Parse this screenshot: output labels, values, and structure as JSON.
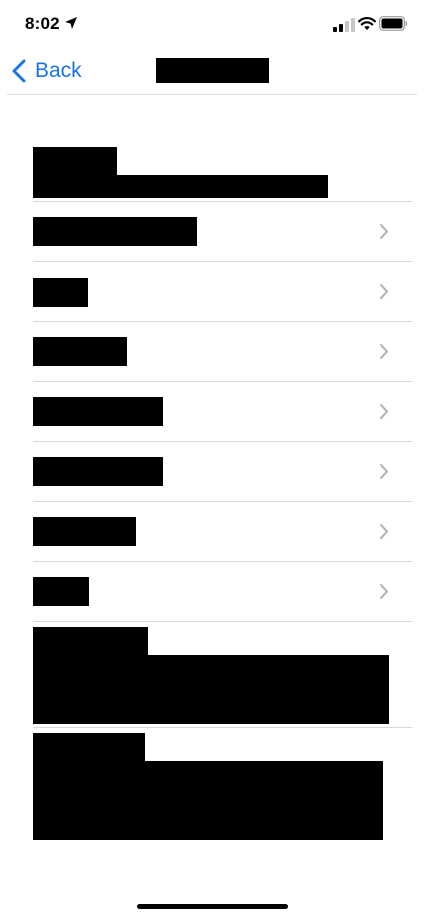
{
  "status_bar": {
    "time": "8:02"
  },
  "nav": {
    "back_label": "Back"
  },
  "icons": {
    "location": "location-arrow-icon",
    "signal": "cellular-signal-icon",
    "wifi": "wifi-icon",
    "battery": "battery-icon",
    "back": "chevron-left-icon",
    "disclosure": "chevron-right-icon"
  },
  "colors": {
    "accent": "#1a73e8",
    "chevron": "#b0b0b5",
    "divider": "#d9d9d9",
    "redaction": "#000000"
  }
}
